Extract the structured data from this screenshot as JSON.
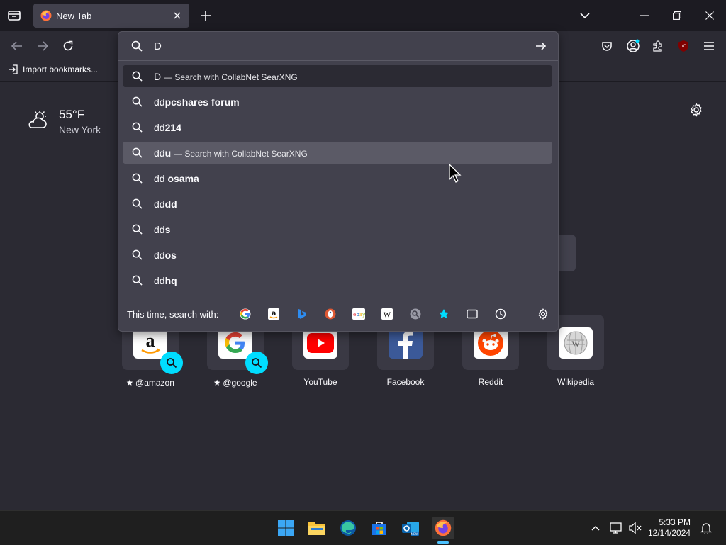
{
  "tab": {
    "title": "New Tab"
  },
  "bookmarks": {
    "import_label": "Import bookmarks..."
  },
  "weather": {
    "temperature": "55°F",
    "location": "New York"
  },
  "urlbar": {
    "value": "D",
    "results": [
      {
        "typed": "D",
        "suffix": "",
        "action": "— Search with CollabNet SearXNG"
      },
      {
        "typed": "dd",
        "suffix": "pcshares forum",
        "action": ""
      },
      {
        "typed": "dd",
        "suffix": "214",
        "action": ""
      },
      {
        "typed": "dd",
        "suffix": "u",
        "action": "— Search with CollabNet SearXNG"
      },
      {
        "typed": "dd",
        "suffix": " osama",
        "action": ""
      },
      {
        "typed": "dd",
        "suffix": "dd",
        "action": ""
      },
      {
        "typed": "dd",
        "suffix": "s",
        "action": ""
      },
      {
        "typed": "dd",
        "suffix": "os",
        "action": ""
      },
      {
        "typed": "dd",
        "suffix": "hq",
        "action": ""
      }
    ],
    "oneoff_label": "This time, search with:",
    "engines": [
      "google-icon",
      "amazon-icon",
      "bing-icon",
      "duckduckgo-icon",
      "ebay-icon",
      "wikipedia-icon",
      "searxng-icon",
      "bookmarks-icon",
      "tabs-icon",
      "history-icon"
    ]
  },
  "shortcuts": [
    {
      "label": "@amazon",
      "sponsored_pin": true
    },
    {
      "label": "@google",
      "sponsored_pin": true
    },
    {
      "label": "YouTube",
      "sponsored_pin": false
    },
    {
      "label": "Facebook",
      "sponsored_pin": false
    },
    {
      "label": "Reddit",
      "sponsored_pin": false
    },
    {
      "label": "Wikipedia",
      "sponsored_pin": false
    }
  ],
  "clock": {
    "time": "5:33 PM",
    "date": "12/14/2024"
  },
  "colors": {
    "accent": "#00ddff",
    "toolbar": "#2b2a33",
    "tabstrip": "#1c1b22",
    "dropdown": "#42414d"
  }
}
